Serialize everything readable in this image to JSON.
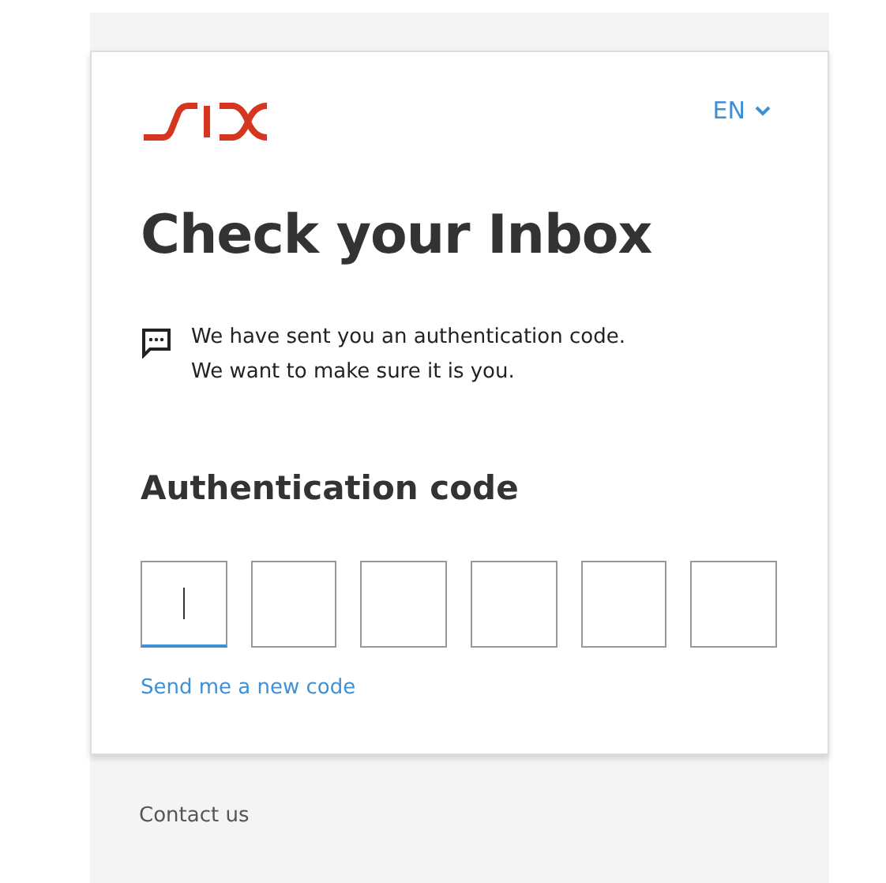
{
  "language": {
    "label": "EN"
  },
  "title": "Check your Inbox",
  "message": [
    "We have sent you an authentication code.",
    "We want to make sure it is you."
  ],
  "code": {
    "label": "Authentication code",
    "digits": [
      {
        "selected": true
      },
      {
        "selected": false
      },
      {
        "selected": false
      },
      {
        "selected": false
      },
      {
        "selected": false
      },
      {
        "selected": false
      }
    ]
  },
  "resend_link": "Send me a new code",
  "footer": {
    "links": [
      "Contact us"
    ]
  }
}
